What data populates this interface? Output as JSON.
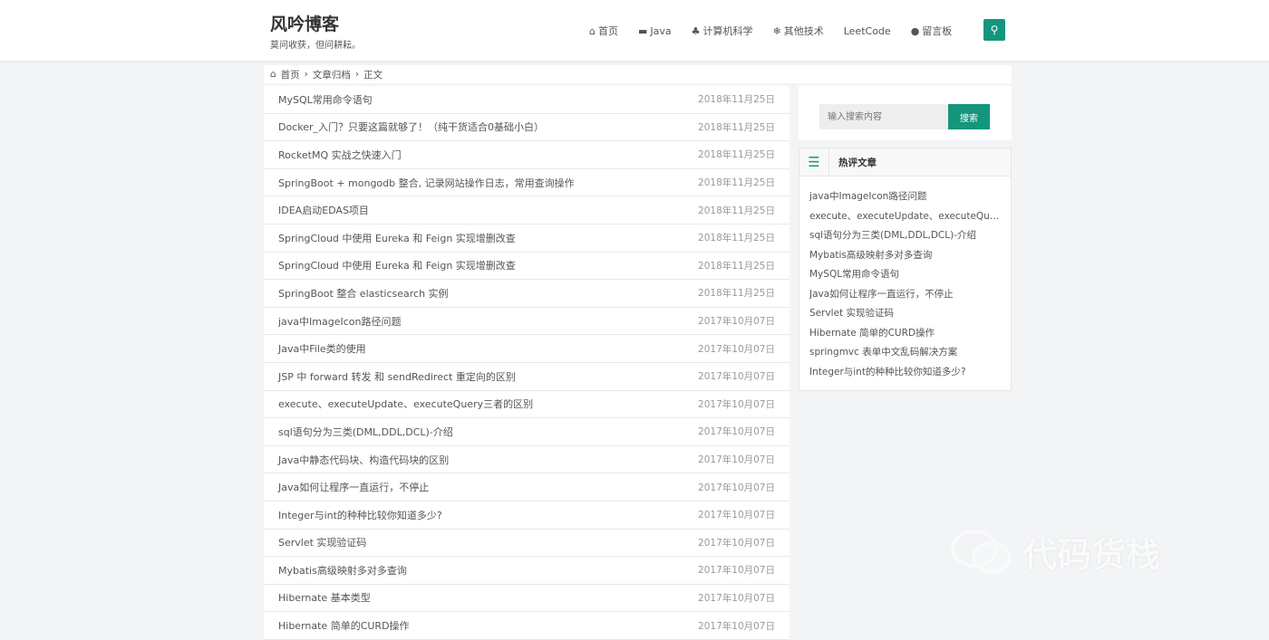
{
  "header": {
    "title": "风吟博客",
    "subtitle": "莫问收获，但问耕耘。",
    "nav": [
      {
        "icon": "home-icon",
        "glyph": "⌂",
        "label": "首页"
      },
      {
        "icon": "book-icon",
        "glyph": "▬",
        "label": "Java"
      },
      {
        "icon": "cubes-icon",
        "glyph": "♣",
        "label": "计算机科学"
      },
      {
        "icon": "snowflake-icon",
        "glyph": "❄",
        "label": "其他技术"
      },
      {
        "icon": "",
        "glyph": "",
        "label": "LeetCode"
      },
      {
        "icon": "comment-icon",
        "glyph": "●",
        "label": "留言板"
      }
    ],
    "search_glyph": "⚲"
  },
  "breadcrumb": {
    "home": "首页",
    "sep": "›",
    "archive": "文章归档",
    "current": "正文"
  },
  "articles": [
    {
      "title": "MySQL常用命令语句",
      "date": "2018年11月25日"
    },
    {
      "title": "Docker_入门？只要这篇就够了！（纯干货适合0基础小白）",
      "date": "2018年11月25日"
    },
    {
      "title": "RocketMQ 实战之快速入门",
      "date": "2018年11月25日"
    },
    {
      "title": "SpringBoot + mongodb 整合, 记录网站操作日志，常用查询操作",
      "date": "2018年11月25日"
    },
    {
      "title": "IDEA启动EDAS项目",
      "date": "2018年11月25日"
    },
    {
      "title": "SpringCloud 中使用 Eureka 和 Feign 实现增删改查",
      "date": "2018年11月25日"
    },
    {
      "title": "SpringCloud 中使用 Eureka 和 Feign 实现增删改查",
      "date": "2018年11月25日"
    },
    {
      "title": "SpringBoot 整合 elasticsearch 实例",
      "date": "2018年11月25日"
    },
    {
      "title": "java中ImageIcon路径问题",
      "date": "2017年10月07日"
    },
    {
      "title": "Java中File类的使用",
      "date": "2017年10月07日"
    },
    {
      "title": "JSP 中 forward 转发 和 sendRedirect 重定向的区别",
      "date": "2017年10月07日"
    },
    {
      "title": "execute、executeUpdate、executeQuery三者的区别",
      "date": "2017年10月07日"
    },
    {
      "title": "sql语句分为三类(DML,DDL,DCL)-介绍",
      "date": "2017年10月07日"
    },
    {
      "title": "Java中静态代码块、构造代码块的区别",
      "date": "2017年10月07日"
    },
    {
      "title": "Java如何让程序一直运行，不停止",
      "date": "2017年10月07日"
    },
    {
      "title": "Integer与int的种种比较你知道多少?",
      "date": "2017年10月07日"
    },
    {
      "title": "Servlet 实现验证码",
      "date": "2017年10月07日"
    },
    {
      "title": "Mybatis高级映射多对多查询",
      "date": "2017年10月07日"
    },
    {
      "title": "Hibernate 基本类型",
      "date": "2017年10月07日"
    },
    {
      "title": "Hibernate 简单的CURD操作",
      "date": "2017年10月07日"
    }
  ],
  "sidebar": {
    "search_placeholder": "输入搜索内容",
    "search_button": "搜索",
    "hot_title": "热评文章",
    "hot": [
      "java中ImageIcon路径问题",
      "execute、executeUpdate、executeQuery三者的区别",
      "sql语句分为三类(DML,DDL,DCL)-介绍",
      "Mybatis高级映射多对多查询",
      "MySQL常用命令语句",
      "Java如何让程序一直运行，不停止",
      "Servlet 实现验证码",
      "Hibernate 简单的CURD操作",
      "springmvc 表单中文乱码解决方案",
      "Integer与int的种种比较你知道多少?"
    ]
  },
  "watermark": "代码货栈",
  "colors": {
    "accent": "#14967d"
  }
}
